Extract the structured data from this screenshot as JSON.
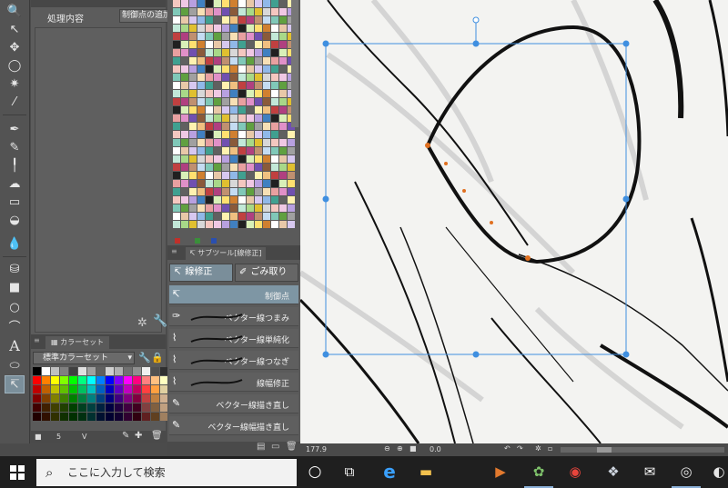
{
  "tool_property": {
    "process_label": "処理内容",
    "process_value": "制御点の追加"
  },
  "color_set": {
    "tab_label": "カラーセット",
    "set_name": "標準カラーセット",
    "swatches": [
      "#000000",
      "#ffffff",
      "#c0c0c0",
      "#808080",
      "#404040",
      "#e0e0e0",
      "#a0a0a0",
      "#606060",
      "#d0d0d0",
      "#b0b0b0",
      "#707070",
      "#909090",
      "#f0f0f0",
      "#505050",
      "#303030",
      "#ff0000",
      "#ff8000",
      "#ffff00",
      "#80ff00",
      "#00ff00",
      "#00ff80",
      "#00ffff",
      "#0080ff",
      "#0000ff",
      "#8000ff",
      "#ff00ff",
      "#ff0080",
      "#ff8080",
      "#ffc080",
      "#ffffc0",
      "#c00000",
      "#c06000",
      "#c0c000",
      "#60c000",
      "#00c000",
      "#00c060",
      "#00c0c0",
      "#0060c0",
      "#0000c0",
      "#6000c0",
      "#c000c0",
      "#c00060",
      "#ff4040",
      "#ffa040",
      "#e0d0a0",
      "#800000",
      "#804000",
      "#808000",
      "#408000",
      "#008000",
      "#008040",
      "#008080",
      "#004080",
      "#000080",
      "#400080",
      "#800080",
      "#800040",
      "#c04040",
      "#c08040",
      "#d0b090",
      "#400000",
      "#402000",
      "#404000",
      "#204000",
      "#004000",
      "#004020",
      "#004040",
      "#002040",
      "#000040",
      "#200040",
      "#400040",
      "#400020",
      "#804040",
      "#806040",
      "#c0a080",
      "#200000",
      "#301000",
      "#303000",
      "#103000",
      "#003000",
      "#003010",
      "#003030",
      "#001030",
      "#000030",
      "#100030",
      "#300030",
      "#300010",
      "#602020",
      "#604020",
      "#a08060"
    ],
    "footer": [
      "5",
      "V"
    ]
  },
  "subtool": {
    "tab_label": "サブツール[線修正]",
    "groups": [
      "線修正",
      "ごみ取り"
    ],
    "items": [
      {
        "label": "制御点",
        "active": true
      },
      {
        "label": "ベクター線つまみ",
        "active": false
      },
      {
        "label": "ベクター線単純化",
        "active": false
      },
      {
        "label": "ベクター線つなぎ",
        "active": false
      },
      {
        "label": "線幅修正",
        "active": false
      },
      {
        "label": "ベクター線描き直し",
        "active": false
      },
      {
        "label": "ベクター線幅描き直し",
        "active": false
      }
    ]
  },
  "status": {
    "zoom": "177.9",
    "angle": "0.0"
  },
  "taskbar": {
    "search_placeholder": "ここに入力して検索"
  }
}
